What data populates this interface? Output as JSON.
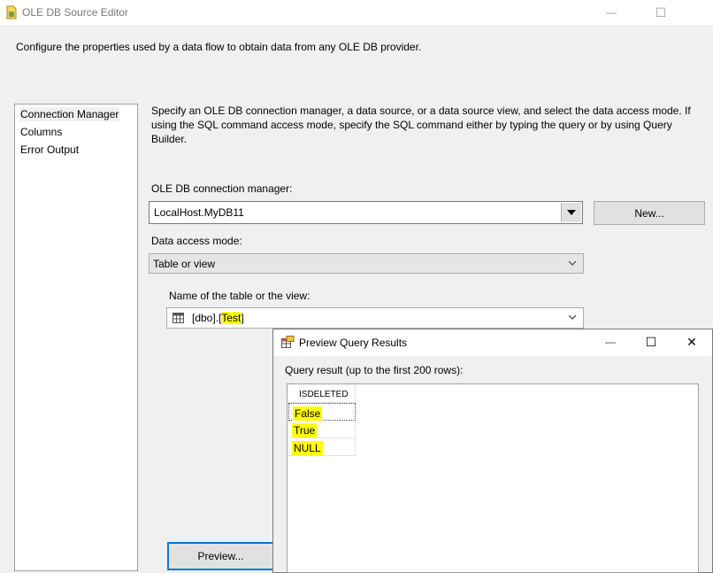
{
  "window": {
    "title": "OLE DB Source Editor",
    "minimize_glyph": "—",
    "maximize_glyph": "☐",
    "app_icon": "ssis-source-icon"
  },
  "header": {
    "description": "Configure the properties used by a data flow to obtain data from any OLE DB provider."
  },
  "nav": {
    "items": [
      {
        "label": "Connection Manager",
        "selected": true
      },
      {
        "label": "Columns",
        "selected": false
      },
      {
        "label": "Error Output",
        "selected": false
      }
    ]
  },
  "main": {
    "instructions": "Specify an OLE DB connection manager, a data source, or a data source view, and select the data access mode. If using the SQL command access mode, specify the SQL command either by typing the query or by using Query Builder.",
    "connection_label": "OLE DB connection manager:",
    "connection_value": "LocalHost.MyDB11",
    "new_button": "New...",
    "access_mode_label": "Data access mode:",
    "access_mode_value": "Table or view",
    "table_label": "Name of the table or the view:",
    "table_value_prefix": "[dbo].[",
    "table_value_highlight": "Test",
    "table_value_suffix": "]",
    "preview_button": "Preview..."
  },
  "preview_dialog": {
    "title": "Preview Query Results",
    "minimize_glyph": "—",
    "maximize_glyph": "☐",
    "close_glyph": "✕",
    "result_label": "Query result (up to the first 200 rows):",
    "columns": [
      "ISDELETED"
    ],
    "rows": [
      "False",
      "True",
      "NULL"
    ]
  },
  "colors": {
    "highlight": "#ffff00",
    "background": "#f0f0f0"
  }
}
